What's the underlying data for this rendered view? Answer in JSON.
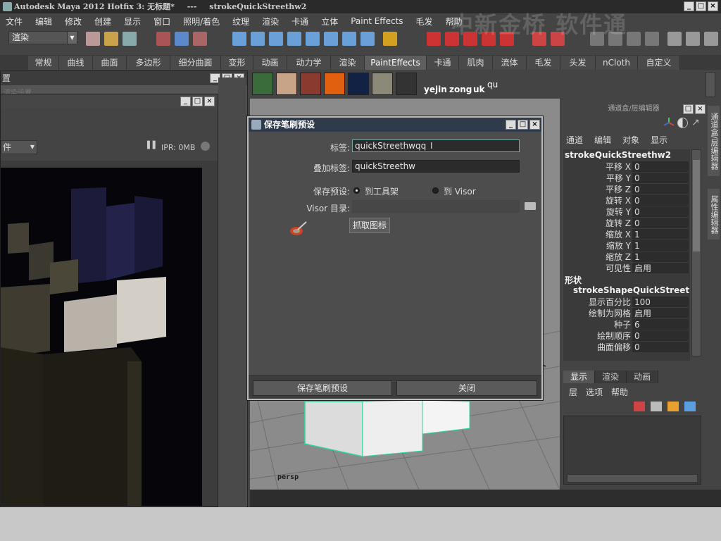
{
  "window": {
    "title_app": "Autodesk Maya 2012 Hotfix 3: 无标题*",
    "title_sep": "---",
    "title_obj": "strokeQuickStreethw2"
  },
  "watermark": "中新金桥 软件通",
  "menubar": [
    "文件",
    "编辑",
    "修改",
    "创建",
    "显示",
    "窗口",
    "照明/着色",
    "纹理",
    "渲染",
    "卡通",
    "立体",
    "Paint Effects",
    "毛发",
    "帮助"
  ],
  "toolbar": {
    "mode": "渲染"
  },
  "shelf_tabs": [
    {
      "label": "常规",
      "active": false
    },
    {
      "label": "曲线",
      "active": false
    },
    {
      "label": "曲面",
      "active": false
    },
    {
      "label": "多边形",
      "active": false
    },
    {
      "label": "细分曲面",
      "active": false
    },
    {
      "label": "变形",
      "active": false
    },
    {
      "label": "动画",
      "active": false
    },
    {
      "label": "动力学",
      "active": false
    },
    {
      "label": "渲染",
      "active": false
    },
    {
      "label": "PaintEffects",
      "active": true
    },
    {
      "label": "卡通",
      "active": false
    },
    {
      "label": "肌肉",
      "active": false
    },
    {
      "label": "流体",
      "active": false
    },
    {
      "label": "毛发",
      "active": false
    },
    {
      "label": "头发",
      "active": false
    },
    {
      "label": "nCloth",
      "active": false
    },
    {
      "label": "自定义",
      "active": false
    }
  ],
  "shelf_labels": [
    "yejin",
    "zong",
    "uk",
    "qu"
  ],
  "back_window": {
    "title_glyph": "置",
    "hint": "渲染设置"
  },
  "render_view": {
    "dropdown": "件",
    "ipr": "IPR: 0MB"
  },
  "viewport": {
    "camera": "persp"
  },
  "dialog": {
    "title": "保存笔刷预设",
    "label_field": "标签:",
    "label_value": "quickStreethwqq",
    "overlay_field": "叠加标签:",
    "overlay_value": "quickStreethw",
    "save_field": "保存预设:",
    "radio_shelf": "到工具架",
    "radio_visor": "到 Visor",
    "visor_field": "Visor 目录:",
    "visor_value": "",
    "grab_button": "抓取图标",
    "save_button": "保存笔刷预设",
    "close_button": "关闭"
  },
  "channel_box": {
    "header": "通道盒/层编辑器",
    "menu": [
      "通道",
      "编辑",
      "对象",
      "显示"
    ],
    "object_name": "strokeQuickStreethw2",
    "attrs": [
      {
        "k": "平移 X",
        "v": "0"
      },
      {
        "k": "平移 Y",
        "v": "0"
      },
      {
        "k": "平移 Z",
        "v": "0"
      },
      {
        "k": "旋转 X",
        "v": "0"
      },
      {
        "k": "旋转 Y",
        "v": "0"
      },
      {
        "k": "旋转 Z",
        "v": "0"
      },
      {
        "k": "缩放 X",
        "v": "1"
      },
      {
        "k": "缩放 Y",
        "v": "1"
      },
      {
        "k": "缩放 Z",
        "v": "1"
      },
      {
        "k": "可见性",
        "v": "启用"
      }
    ],
    "shapes_header": "形状",
    "shape_name": "strokeShapeQuickStreet...",
    "shape_attrs": [
      {
        "k": "显示百分比",
        "v": "100"
      },
      {
        "k": "绘制为网格",
        "v": "启用"
      },
      {
        "k": "种子",
        "v": "6"
      },
      {
        "k": "绘制顺序",
        "v": "0"
      },
      {
        "k": "曲面偏移",
        "v": "0"
      }
    ]
  },
  "side_tabs": [
    "通道盒/层编辑器",
    "属性编辑器"
  ],
  "layer_editor": {
    "tabs": [
      {
        "label": "显示",
        "active": true
      },
      {
        "label": "渲染",
        "active": false
      },
      {
        "label": "动画",
        "active": false
      }
    ],
    "menu": [
      "层",
      "选项",
      "帮助"
    ]
  }
}
